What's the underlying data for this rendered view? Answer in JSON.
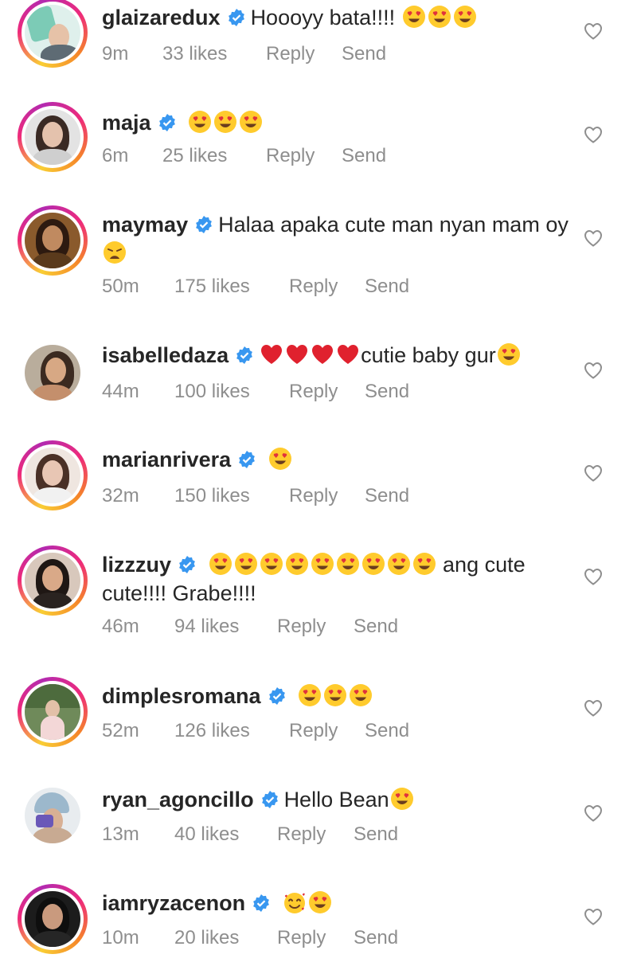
{
  "colors": {
    "verified_blue": "#3897f0",
    "meta_gray": "#8e8e8e",
    "text_dark": "#262626",
    "story_ring": [
      "#f9ce34",
      "#ee2a7b",
      "#b32ab0"
    ]
  },
  "labels": {
    "reply": "Reply",
    "send": "Send"
  },
  "comments": [
    {
      "username": "glaizaredux",
      "verified": true,
      "text_before": "Hoooyy bata!!!!",
      "emojis": [
        "heart-eyes",
        "heart-eyes",
        "heart-eyes"
      ],
      "text_after": "",
      "time": "9m",
      "likes": "33 likes",
      "avatar_icon": "avatar-photo",
      "story_ring": true
    },
    {
      "username": "maja",
      "verified": true,
      "text_before": "",
      "emojis": [
        "heart-eyes",
        "heart-eyes",
        "heart-eyes"
      ],
      "text_after": "",
      "time": "6m",
      "likes": "25 likes",
      "avatar_icon": "avatar-photo",
      "story_ring": true
    },
    {
      "username": "maymay",
      "verified": true,
      "text_before": "Halaa apaka cute man nyan mam oy",
      "emojis": [
        "weary-face"
      ],
      "text_after": "",
      "time": "50m",
      "likes": "175 likes",
      "avatar_icon": "avatar-photo",
      "story_ring": true
    },
    {
      "username": "isabelledaza",
      "verified": true,
      "text_before": "",
      "emojis": [
        "red-heart",
        "red-heart",
        "red-heart",
        "red-heart"
      ],
      "text_after": "cutie baby gur",
      "emojis_after": [
        "heart-eyes"
      ],
      "time": "44m",
      "likes": "100 likes",
      "avatar_icon": "avatar-photo",
      "story_ring": false
    },
    {
      "username": "marianrivera",
      "verified": true,
      "text_before": "",
      "emojis": [
        "heart-eyes"
      ],
      "text_after": "",
      "time": "32m",
      "likes": "150 likes",
      "avatar_icon": "avatar-photo",
      "story_ring": true
    },
    {
      "username": "lizzzuy",
      "verified": true,
      "text_before": "",
      "emojis": [
        "heart-eyes",
        "heart-eyes",
        "heart-eyes",
        "heart-eyes",
        "heart-eyes",
        "heart-eyes",
        "heart-eyes",
        "heart-eyes",
        "heart-eyes"
      ],
      "text_after": " ang cute cute!!!! Grabe!!!!",
      "time": "46m",
      "likes": "94 likes",
      "avatar_icon": "avatar-photo",
      "story_ring": true
    },
    {
      "username": "dimplesromana",
      "verified": true,
      "text_before": "",
      "emojis": [
        "heart-eyes",
        "heart-eyes",
        "heart-eyes"
      ],
      "text_after": "",
      "time": "52m",
      "likes": "126 likes",
      "avatar_icon": "avatar-photo",
      "story_ring": true
    },
    {
      "username": "ryan_agoncillo",
      "verified": true,
      "text_before": "Hello Bean",
      "emojis": [
        "heart-eyes"
      ],
      "text_after": "",
      "time": "13m",
      "likes": "40 likes",
      "avatar_icon": "avatar-photo",
      "story_ring": false
    },
    {
      "username": "iamryzacenon",
      "verified": true,
      "text_before": "",
      "emojis": [
        "smiling-face-with-hearts",
        "heart-eyes"
      ],
      "text_after": "",
      "time": "10m",
      "likes": "20 likes",
      "avatar_icon": "avatar-photo",
      "story_ring": true
    }
  ]
}
